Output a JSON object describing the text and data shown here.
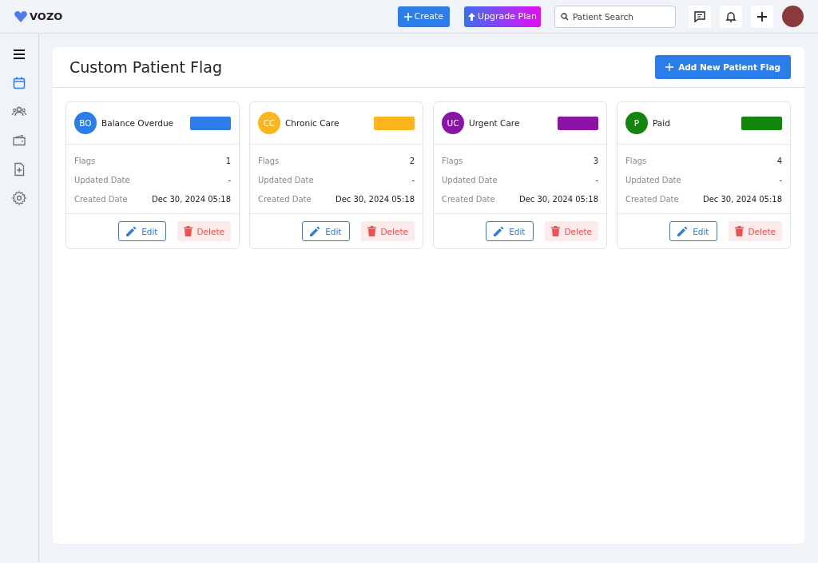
{
  "header": {
    "logo": "VOZO",
    "create_button": "Create",
    "upgrade_button": "Upgrade Plan",
    "search": {
      "placeholder": "Patient Search"
    }
  },
  "sidebar": {
    "items": [
      {
        "kind": "menu",
        "selected": false
      },
      {
        "kind": "calendar",
        "selected": true
      },
      {
        "kind": "people",
        "selected": false
      },
      {
        "kind": "wallet",
        "selected": false
      },
      {
        "kind": "document",
        "selected": false
      },
      {
        "kind": "settings",
        "selected": false
      }
    ]
  },
  "page": {
    "title": "Custom Patient Flag",
    "add_button": "Add New Patient Flag"
  },
  "flags": [
    {
      "initials": "BO",
      "name": "Balance Overdue",
      "color": "#2b7de9",
      "flags_label": "Flags",
      "flags": "1",
      "updated_label": "Updated Date",
      "updated": "-",
      "created_label": "Created Date",
      "created": "Dec 30, 2024 05:18",
      "edit": "Edit",
      "delete": "Delete"
    },
    {
      "initials": "CC",
      "name": "Chronic Care",
      "color": "#fdb51e",
      "flags_label": "Flags",
      "flags": "2",
      "updated_label": "Updated Date",
      "updated": "-",
      "created_label": "Created Date",
      "created": "Dec 30, 2024 05:18",
      "edit": "Edit",
      "delete": "Delete"
    },
    {
      "initials": "UC",
      "name": "Urgent Care",
      "color": "#8b14a7",
      "flags_label": "Flags",
      "flags": "3",
      "updated_label": "Updated Date",
      "updated": "-",
      "created_label": "Created Date",
      "created": "Dec 30, 2024 05:18",
      "edit": "Edit",
      "delete": "Delete"
    },
    {
      "initials": "P",
      "name": "Paid",
      "color": "#13860f",
      "flags_label": "Flags",
      "flags": "4",
      "updated_label": "Updated Date",
      "updated": "-",
      "created_label": "Created Date",
      "created": "Dec 30, 2024 05:18",
      "edit": "Edit",
      "delete": "Delete"
    }
  ]
}
